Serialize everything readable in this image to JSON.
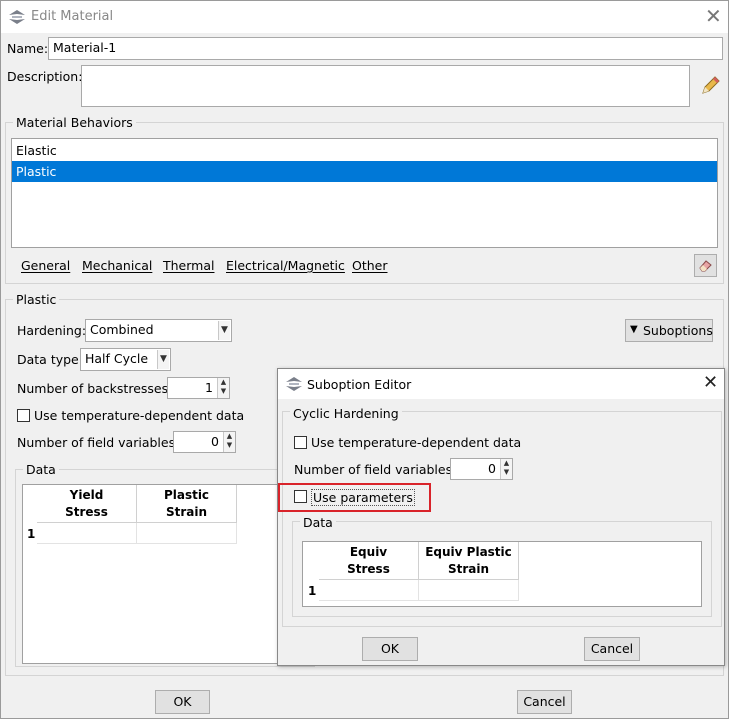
{
  "window": {
    "title": "Edit Material"
  },
  "name": {
    "label": "Name:",
    "value": "Material-1"
  },
  "description": {
    "label": "Description:",
    "value": ""
  },
  "behaviors": {
    "group_label": "Material Behaviors",
    "items": [
      "Elastic",
      "Plastic"
    ],
    "selected": "Plastic",
    "menus": [
      "General",
      "Mechanical",
      "Thermal",
      "Electrical/Magnetic",
      "Other"
    ]
  },
  "plastic": {
    "group_label": "Plastic",
    "hardening_label": "Hardening:",
    "hardening_value": "Combined",
    "datatype_label": "Data type:",
    "datatype_value": "Half Cycle",
    "backstresses_label": "Number of backstresses:",
    "backstresses_value": "1",
    "temp_dep_label": "Use temperature-dependent data",
    "field_vars_label": "Number of field variables:",
    "field_vars_value": "0",
    "suboptions_label": "Suboptions",
    "data_label": "Data",
    "columns": [
      [
        "Yield",
        "Stress"
      ],
      [
        "Plastic",
        "Strain"
      ]
    ],
    "row_index": "1"
  },
  "suboption_editor": {
    "title": "Suboption Editor",
    "group_label": "Cyclic Hardening",
    "temp_dep_label": "Use temperature-dependent data",
    "field_vars_label": "Number of field variables:",
    "field_vars_value": "0",
    "use_params_label": "Use parameters",
    "data_label": "Data",
    "columns": [
      [
        "Equiv",
        "Stress"
      ],
      [
        "Equiv Plastic",
        "Strain"
      ]
    ],
    "row_index": "1",
    "ok_label": "OK",
    "cancel_label": "Cancel"
  },
  "buttons": {
    "ok_label": "OK",
    "cancel_label": "Cancel"
  },
  "colors": {
    "selection": "#0078d7",
    "highlight_box": "#d9232a"
  }
}
